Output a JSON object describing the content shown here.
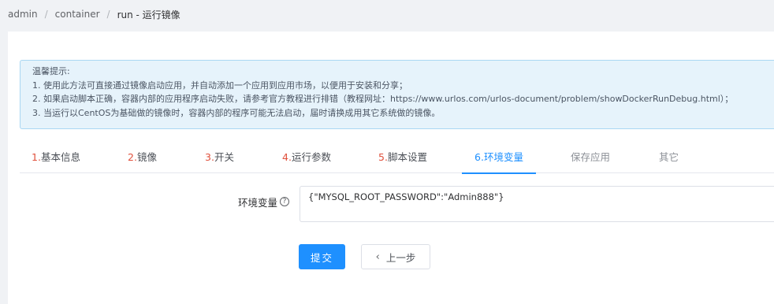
{
  "breadcrumb": {
    "items": [
      "admin",
      "container",
      "run"
    ],
    "separator": "/",
    "current": "run - 运行镜像"
  },
  "tip": {
    "title": "温馨提示:",
    "lines": [
      "1. 使用此方法可直接通过镜像启动应用，并自动添加一个应用到应用市场，以便用于安装和分享；",
      "2. 如果启动脚本正确，容器内部的应用程序启动失败，请参考官方教程进行排错（教程网址：https://www.urlos.com/urlos-document/problem/showDockerRunDebug.html）；",
      "3. 当运行以CentOS为基础做的镜像时，容器内部的程序可能无法启动，届时请换成用其它系统做的镜像。"
    ]
  },
  "tabs": [
    {
      "num": "1.",
      "label": "基本信息",
      "state": "done"
    },
    {
      "num": "2.",
      "label": "镜像",
      "state": "done"
    },
    {
      "num": "3.",
      "label": "开关",
      "state": "done"
    },
    {
      "num": "4.",
      "label": "运行参数",
      "state": "done"
    },
    {
      "num": "5.",
      "label": "脚本设置",
      "state": "done"
    },
    {
      "num": "6.",
      "label": "环境变量",
      "state": "active"
    },
    {
      "num": "",
      "label": "保存应用",
      "state": "disabled"
    },
    {
      "num": "",
      "label": "其它",
      "state": "disabled"
    }
  ],
  "form": {
    "env_label": "环境变量",
    "help_icon": "?",
    "env_value": "{\"MYSQL_ROOT_PASSWORD\":\"Admin888\"}"
  },
  "buttons": {
    "submit": "提交",
    "prev_icon": "‹",
    "prev": "上一步"
  },
  "colors": {
    "accent": "#1e90ff",
    "step_number": "#e0503c",
    "tip_background": "#e6f3fb",
    "tip_border": "#a9d7f3"
  }
}
